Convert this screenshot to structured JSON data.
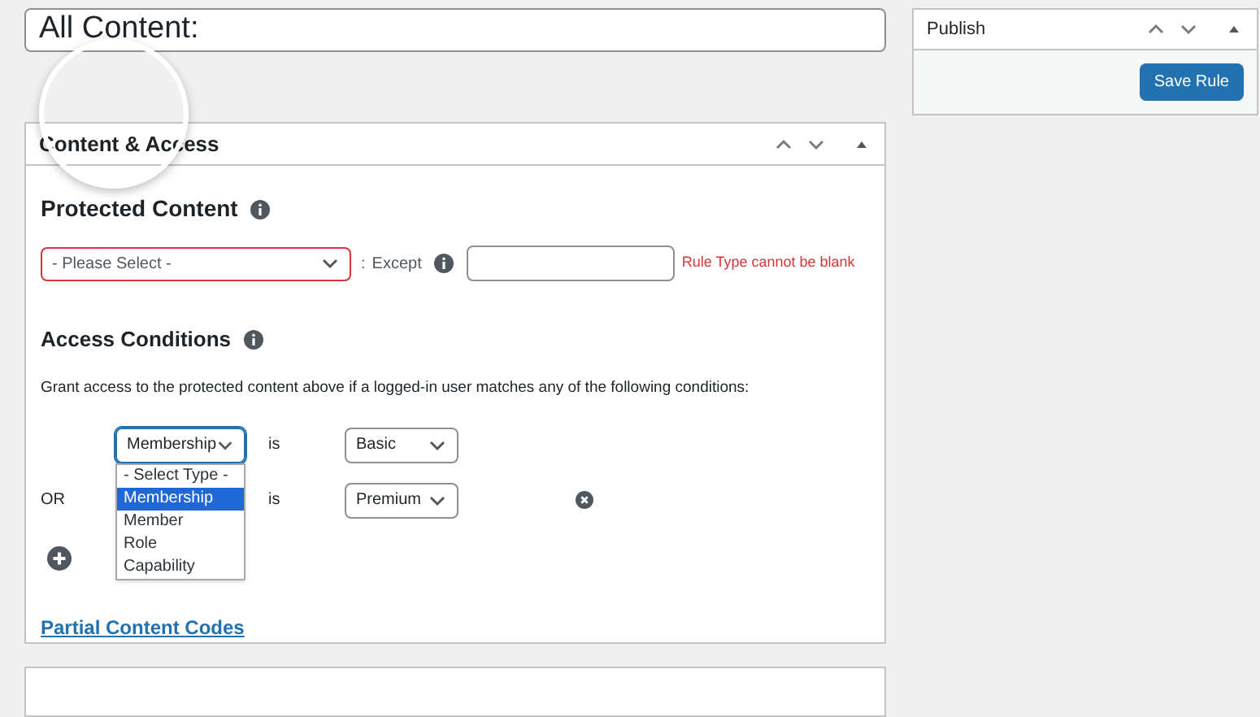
{
  "title_field": {
    "value": "All Content:"
  },
  "content_box": {
    "title": "Content & Access",
    "protected": {
      "heading": "Protected Content",
      "select": {
        "value": "- Please Select -",
        "invalid": true
      },
      "separator": ":",
      "except_label": "Except",
      "error": "Rule Type cannot be blank"
    },
    "access": {
      "heading": "Access Conditions",
      "description": "Grant access to the protected content above if a logged-in user matches any of the following conditions:",
      "conditions": [
        {
          "type": "Membership",
          "operator": "is",
          "value": "Basic",
          "removable": false,
          "open": true
        },
        {
          "prefix": "OR",
          "operator": "is",
          "value": "Premium",
          "removable": true,
          "open": false
        }
      ],
      "type_options": [
        {
          "label": "- Select Type -",
          "selected": false
        },
        {
          "label": "Membership",
          "selected": true
        },
        {
          "label": "Member",
          "selected": false
        },
        {
          "label": "Role",
          "selected": false
        },
        {
          "label": "Capability",
          "selected": false
        }
      ]
    },
    "link": "Partial Content Codes"
  },
  "publish": {
    "title": "Publish",
    "button": "Save Rule"
  }
}
